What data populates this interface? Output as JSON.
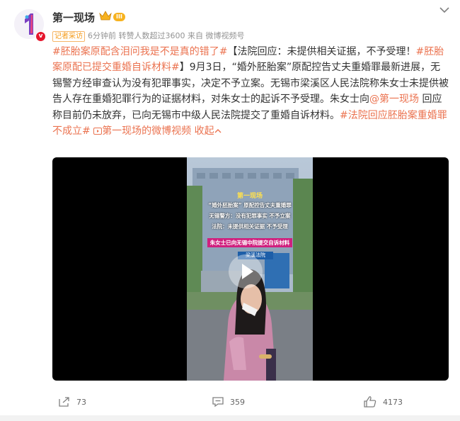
{
  "account": {
    "name": "第一现场",
    "level_badge": "III",
    "verified_mark": "v"
  },
  "meta": {
    "tag": "记者采访",
    "time": "6分钟前",
    "reposts_note": "转赞人数超过3600",
    "source_prefix": "来自",
    "source": "微博视频号"
  },
  "post": {
    "hashtag1": "#胚胎案原配含泪问我是不是真的错了#",
    "headline": "【法院回应：未提供相关证据，不予受理！",
    "hashtag2": "#胚胎案原配已提交重婚自诉材料#",
    "body1": "】9月3日，",
    "quote": "“婚外胚胎案”",
    "body2": "原配控告丈夫重婚罪最新进展，无锡警方经审查认为没有犯罪事实，决定不予立案。无锡市梁溪区人民法院称朱女士未提供被告人存在重婚犯罪行为的证据材料，对朱女士的起诉不予受理。朱女士向",
    "mention": "@第一现场",
    "body3": "回应称目前仍未放弃，已向无锡市中级人民法院提交了重婚自诉材料。",
    "hashtag3": "#法院回应胚胎案重婚罪不成立#",
    "video_link": "第一现场的微博视频",
    "collapse": "收起"
  },
  "video": {
    "logo_text": "第一现场",
    "overlay_lines": [
      "“婚外胚胎案” 原配控告丈夫重婚罪",
      "无锡警方：没有犯罪事实 不予立案",
      "法院：未提供相关证据 不予受理"
    ],
    "banner": "朱女士已向无锡中院提交自诉材料",
    "sign_text": "梁溪法院"
  },
  "actions": {
    "repost_count": "73",
    "comment_count": "359",
    "like_count": "4173"
  },
  "colors": {
    "accent": "#eb7350",
    "text": "#333333",
    "meta": "#939393",
    "verified": "#e6162d",
    "level": "#f7b21e"
  },
  "icons": [
    "chevron-down-icon",
    "crown-icon",
    "video-link-icon",
    "play-icon",
    "repost-icon",
    "comment-icon",
    "like-icon"
  ]
}
